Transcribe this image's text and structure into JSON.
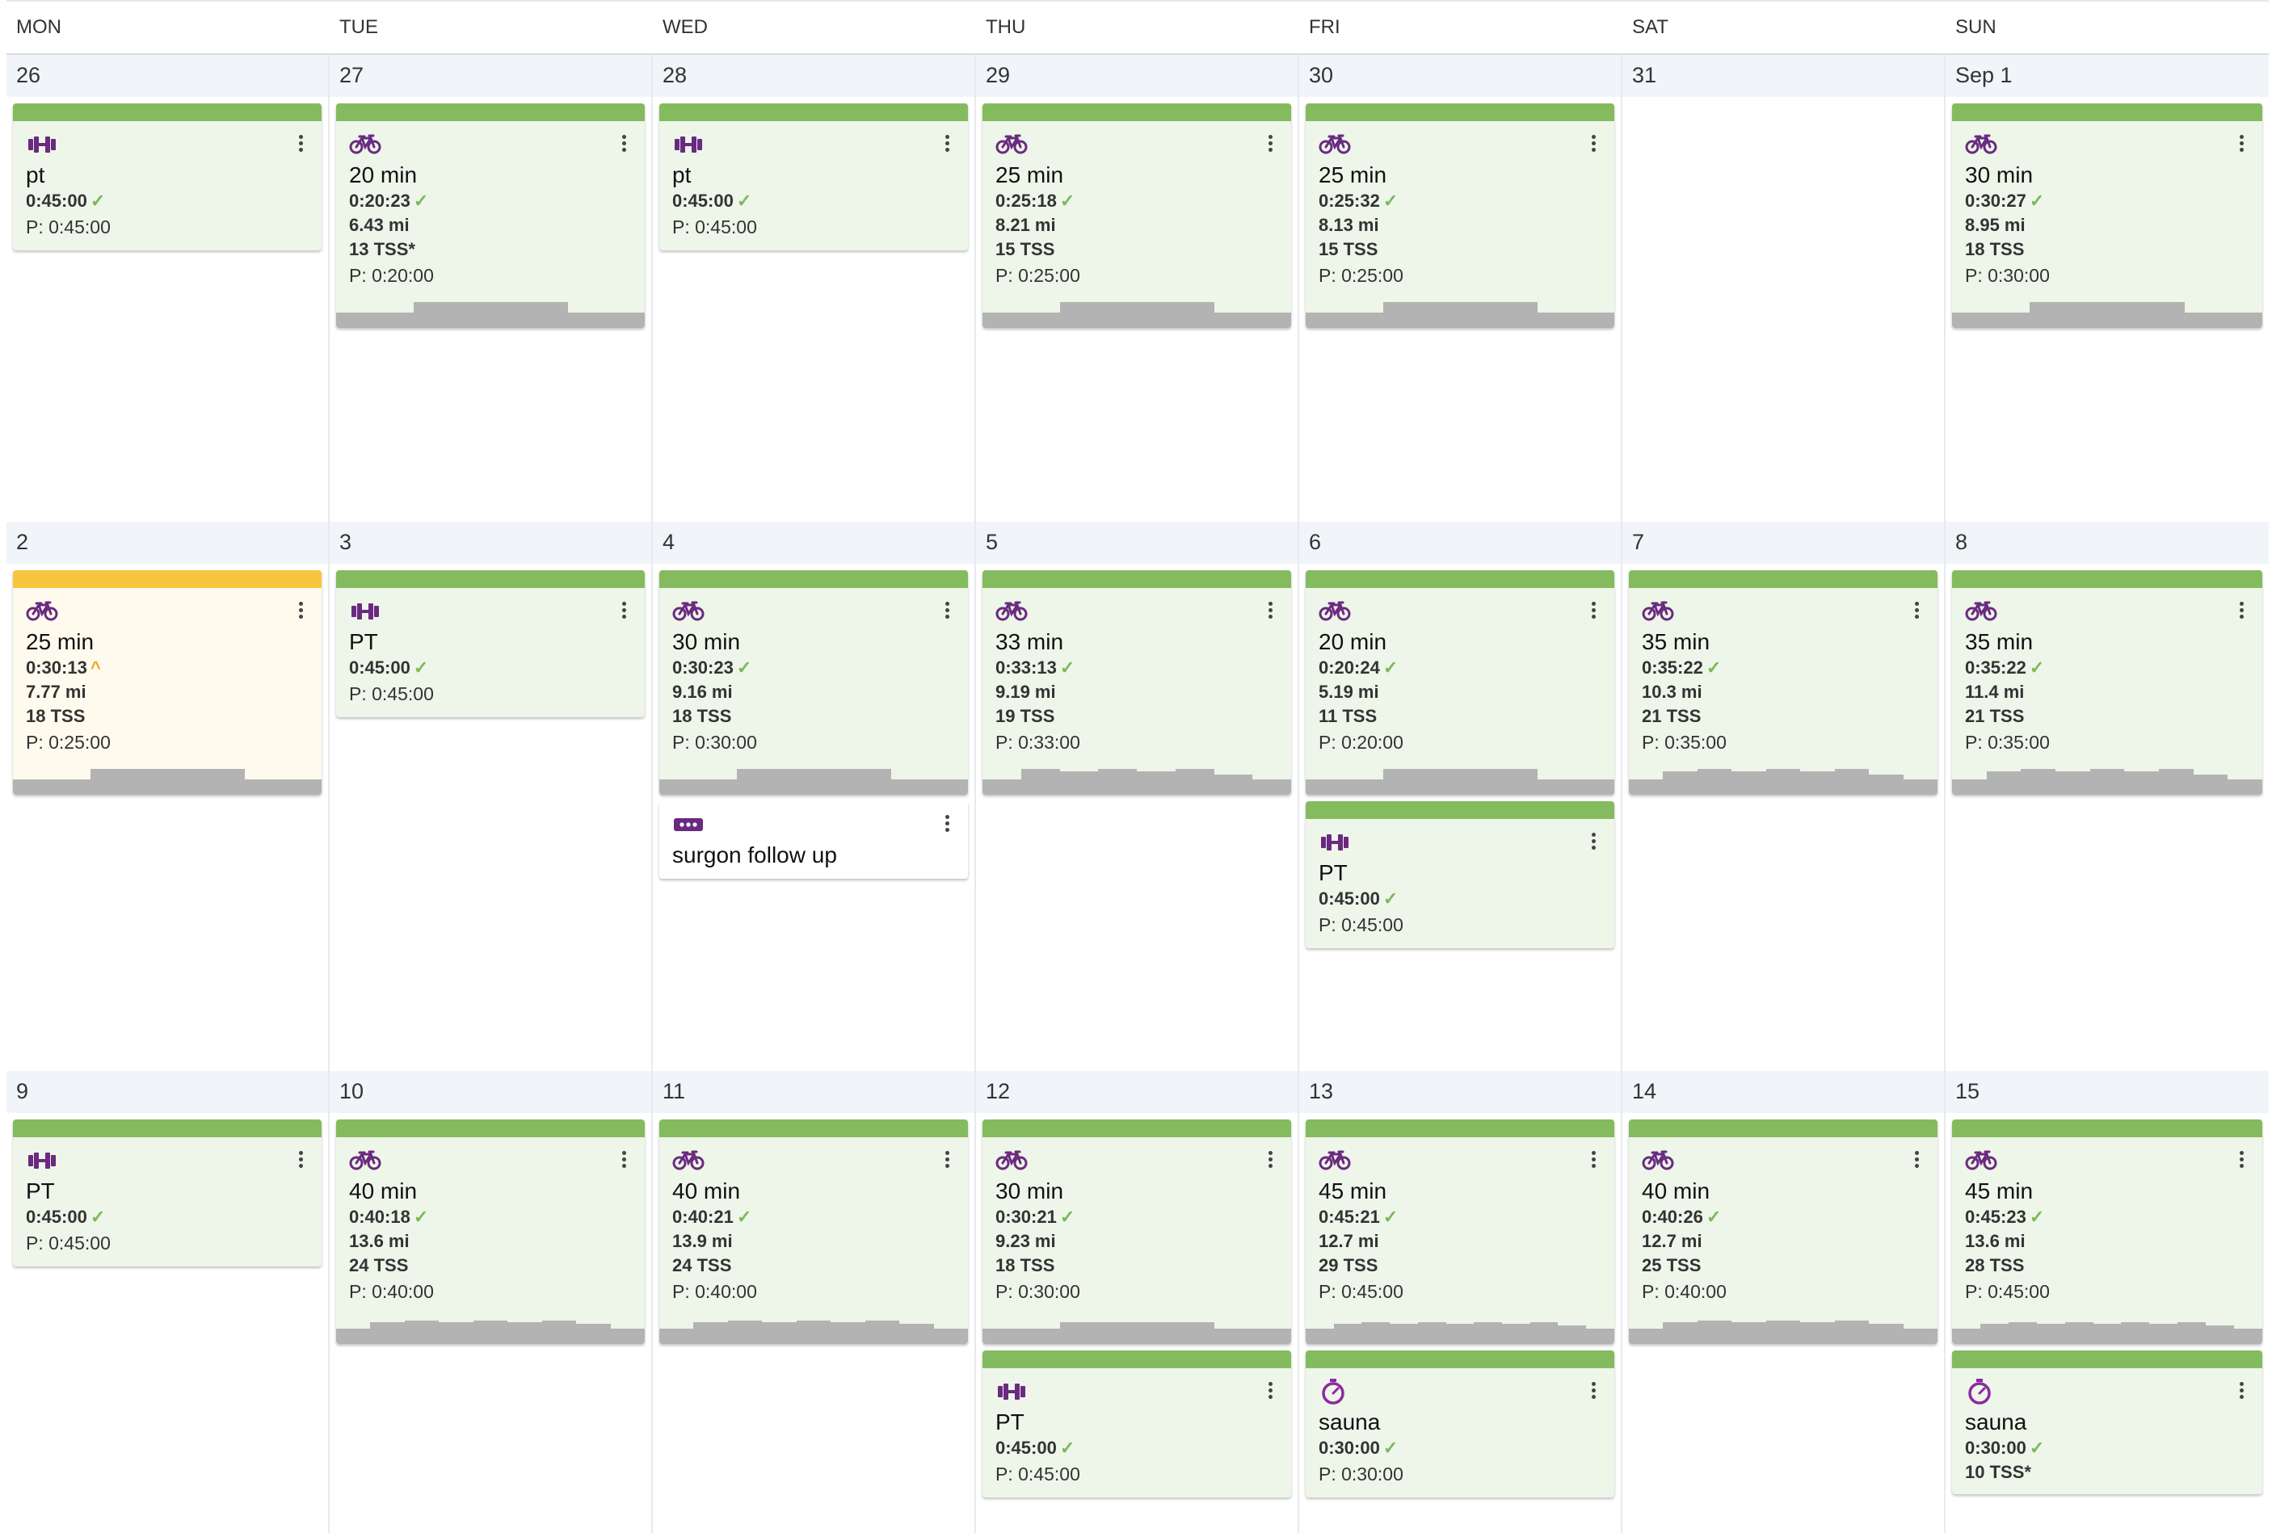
{
  "day_headers": [
    "MON",
    "TUE",
    "WED",
    "THU",
    "FRI",
    "SAT",
    "SUN"
  ],
  "colors": {
    "completed": "#85bb5f",
    "partial": "#f7c53e",
    "icon": "#6a2a80",
    "chart": "#b3b3b3"
  },
  "weeks": [
    {
      "days": [
        {
          "label": "26",
          "workouts": [
            {
              "type": "strength",
              "icon": "dumbbell-icon",
              "title": "pt",
              "duration": "0:45:00",
              "mark": "✓",
              "stats": [],
              "planned": "P: 0:45:00",
              "bars": []
            }
          ]
        },
        {
          "label": "27",
          "workouts": [
            {
              "type": "bike",
              "icon": "bike-icon",
              "title": "20 min",
              "duration": "0:20:23",
              "mark": "✓",
              "stats": [
                "6.43 mi",
                "13 TSS*"
              ],
              "planned": "P: 0:20:00",
              "bars": [
                0.45,
                0.75,
                0.45
              ]
            }
          ]
        },
        {
          "label": "28",
          "workouts": [
            {
              "type": "strength",
              "icon": "dumbbell-icon",
              "title": "pt",
              "duration": "0:45:00",
              "mark": "✓",
              "stats": [],
              "planned": "P: 0:45:00",
              "bars": []
            }
          ]
        },
        {
          "label": "29",
          "workouts": [
            {
              "type": "bike",
              "icon": "bike-icon",
              "title": "25 min",
              "duration": "0:25:18",
              "mark": "✓",
              "stats": [
                "8.21 mi",
                "15 TSS"
              ],
              "planned": "P: 0:25:00",
              "bars": [
                0.45,
                0.75,
                0.45
              ]
            }
          ]
        },
        {
          "label": "30",
          "workouts": [
            {
              "type": "bike",
              "icon": "bike-icon",
              "title": "25 min",
              "duration": "0:25:32",
              "mark": "✓",
              "stats": [
                "8.13 mi",
                "15 TSS"
              ],
              "planned": "P: 0:25:00",
              "bars": [
                0.45,
                0.75,
                0.45
              ]
            }
          ]
        },
        {
          "label": "31",
          "workouts": []
        },
        {
          "label": "Sep 1",
          "workouts": [
            {
              "type": "bike",
              "icon": "bike-icon",
              "title": "30 min",
              "duration": "0:30:27",
              "mark": "✓",
              "stats": [
                "8.95 mi",
                "18 TSS"
              ],
              "planned": "P: 0:30:00",
              "bars": [
                0.45,
                0.75,
                0.45
              ]
            }
          ]
        }
      ]
    },
    {
      "days": [
        {
          "label": "2",
          "workouts": [
            {
              "type": "bike",
              "icon": "bike-icon",
              "status": "warn",
              "title": "25 min",
              "duration": "0:30:13",
              "mark": "^",
              "stats": [
                "7.77 mi",
                "18 TSS"
              ],
              "planned": "P: 0:25:00",
              "bars": [
                0.45,
                0.75,
                0.45
              ]
            }
          ]
        },
        {
          "label": "3",
          "workouts": [
            {
              "type": "strength",
              "icon": "dumbbell-icon",
              "title": "PT",
              "duration": "0:45:00",
              "mark": "✓",
              "stats": [],
              "planned": "P: 0:45:00",
              "bars": []
            }
          ]
        },
        {
          "label": "4",
          "workouts": [
            {
              "type": "bike",
              "icon": "bike-icon",
              "title": "30 min",
              "duration": "0:30:23",
              "mark": "✓",
              "stats": [
                "9.16 mi",
                "18 TSS"
              ],
              "planned": "P: 0:30:00",
              "bars": [
                0.45,
                0.75,
                0.45
              ]
            },
            {
              "type": "event",
              "icon": "more-icon",
              "status": "white",
              "title": "surgon follow up",
              "duration": "",
              "mark": "",
              "stats": [],
              "planned": "",
              "bars": []
            }
          ]
        },
        {
          "label": "5",
          "workouts": [
            {
              "type": "bike",
              "icon": "bike-icon",
              "title": "33 min",
              "duration": "0:33:13",
              "mark": "✓",
              "stats": [
                "9.19 mi",
                "19 TSS"
              ],
              "planned": "P: 0:33:00",
              "bars": [
                0.45,
                0.75,
                0.7,
                0.75,
                0.7,
                0.75,
                0.6,
                0.45
              ]
            }
          ]
        },
        {
          "label": "6",
          "workouts": [
            {
              "type": "bike",
              "icon": "bike-icon",
              "title": "20 min",
              "duration": "0:20:24",
              "mark": "✓",
              "stats": [
                "5.19 mi",
                "11 TSS"
              ],
              "planned": "P: 0:20:00",
              "bars": [
                0.45,
                0.75,
                0.45
              ]
            },
            {
              "type": "strength",
              "icon": "dumbbell-icon",
              "title": "PT",
              "duration": "0:45:00",
              "mark": "✓",
              "stats": [],
              "planned": "P: 0:45:00",
              "bars": []
            }
          ]
        },
        {
          "label": "7",
          "workouts": [
            {
              "type": "bike",
              "icon": "bike-icon",
              "title": "35 min",
              "duration": "0:35:22",
              "mark": "✓",
              "stats": [
                "10.3 mi",
                "21 TSS"
              ],
              "planned": "P: 0:35:00",
              "bars": [
                0.45,
                0.7,
                0.75,
                0.7,
                0.75,
                0.7,
                0.75,
                0.6,
                0.45
              ]
            }
          ]
        },
        {
          "label": "8",
          "workouts": [
            {
              "type": "bike",
              "icon": "bike-icon",
              "title": "35 min",
              "duration": "0:35:22",
              "mark": "✓",
              "stats": [
                "11.4 mi",
                "21 TSS"
              ],
              "planned": "P: 0:35:00",
              "bars": [
                0.45,
                0.7,
                0.75,
                0.7,
                0.75,
                0.7,
                0.75,
                0.6,
                0.45
              ]
            }
          ]
        }
      ]
    },
    {
      "days": [
        {
          "label": "9",
          "workouts": [
            {
              "type": "strength",
              "icon": "dumbbell-icon",
              "title": "PT",
              "duration": "0:45:00",
              "mark": "✓",
              "stats": [],
              "planned": "P: 0:45:00",
              "bars": []
            }
          ]
        },
        {
          "label": "10",
          "workouts": [
            {
              "type": "bike",
              "icon": "bike-icon",
              "title": "40 min",
              "duration": "0:40:18",
              "mark": "✓",
              "stats": [
                "13.6 mi",
                "24 TSS"
              ],
              "planned": "P: 0:40:00",
              "bars": [
                0.45,
                0.65,
                0.7,
                0.65,
                0.7,
                0.65,
                0.7,
                0.6,
                0.45
              ]
            }
          ]
        },
        {
          "label": "11",
          "workouts": [
            {
              "type": "bike",
              "icon": "bike-icon",
              "title": "40 min",
              "duration": "0:40:21",
              "mark": "✓",
              "stats": [
                "13.9 mi",
                "24 TSS"
              ],
              "planned": "P: 0:40:00",
              "bars": [
                0.45,
                0.65,
                0.7,
                0.65,
                0.7,
                0.65,
                0.7,
                0.6,
                0.45
              ]
            }
          ]
        },
        {
          "label": "12",
          "workouts": [
            {
              "type": "bike",
              "icon": "bike-icon",
              "title": "30 min",
              "duration": "0:30:21",
              "mark": "✓",
              "stats": [
                "9.23 mi",
                "18 TSS"
              ],
              "planned": "P: 0:30:00",
              "bars": [
                0.45,
                0.65,
                0.45
              ]
            },
            {
              "type": "strength",
              "icon": "dumbbell-icon",
              "title": "PT",
              "duration": "0:45:00",
              "mark": "✓",
              "stats": [],
              "planned": "P: 0:45:00",
              "bars": []
            }
          ]
        },
        {
          "label": "13",
          "workouts": [
            {
              "type": "bike",
              "icon": "bike-icon",
              "title": "45 min",
              "duration": "0:45:21",
              "mark": "✓",
              "stats": [
                "12.7 mi",
                "29 TSS"
              ],
              "planned": "P: 0:45:00",
              "bars": [
                0.45,
                0.6,
                0.65,
                0.6,
                0.65,
                0.6,
                0.65,
                0.6,
                0.65,
                0.55,
                0.45
              ]
            },
            {
              "type": "sauna",
              "icon": "stopwatch-icon",
              "title": "sauna",
              "duration": "0:30:00",
              "mark": "✓",
              "stats": [],
              "planned": "P: 0:30:00",
              "bars": []
            }
          ]
        },
        {
          "label": "14",
          "workouts": [
            {
              "type": "bike",
              "icon": "bike-icon",
              "title": "40 min",
              "duration": "0:40:26",
              "mark": "✓",
              "stats": [
                "12.7 mi",
                "25 TSS"
              ],
              "planned": "P: 0:40:00",
              "bars": [
                0.45,
                0.65,
                0.7,
                0.65,
                0.7,
                0.65,
                0.7,
                0.6,
                0.45
              ]
            }
          ]
        },
        {
          "label": "15",
          "workouts": [
            {
              "type": "bike",
              "icon": "bike-icon",
              "title": "45 min",
              "duration": "0:45:23",
              "mark": "✓",
              "stats": [
                "13.6 mi",
                "28 TSS"
              ],
              "planned": "P: 0:45:00",
              "bars": [
                0.45,
                0.6,
                0.65,
                0.6,
                0.65,
                0.6,
                0.65,
                0.6,
                0.65,
                0.55,
                0.45
              ]
            },
            {
              "type": "sauna",
              "icon": "stopwatch-icon",
              "title": "sauna",
              "duration": "0:30:00",
              "mark": "✓",
              "stats": [
                "10 TSS*"
              ],
              "planned": "",
              "bars": []
            }
          ]
        }
      ]
    }
  ]
}
